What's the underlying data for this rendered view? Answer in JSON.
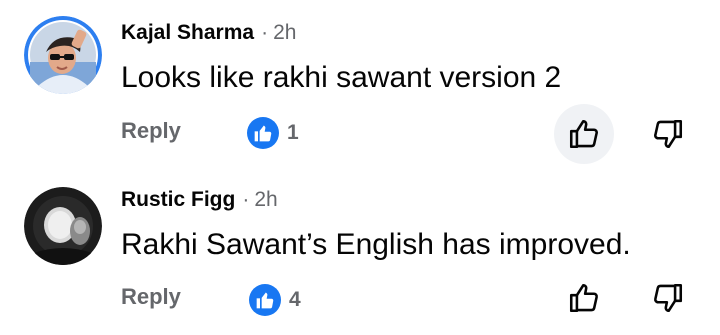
{
  "comments": [
    {
      "author": "Kajal Sharma",
      "separator": "·",
      "time": "2h",
      "text": "Looks like rakhi sawant version 2",
      "reply_label": "Reply",
      "like_count": "1",
      "avatar_icon": "profile-photo-person-with-sunglasses",
      "upvote_icon": "thumbs-up-outline-icon",
      "downvote_icon": "thumbs-down-outline-icon"
    },
    {
      "author": "Rustic Figg",
      "separator": "·",
      "time": "2h",
      "text": "Rakhi Sawant’s English has improved.",
      "reply_label": "Reply",
      "like_count": "4",
      "avatar_icon": "profile-photo-dark-monochrome",
      "upvote_icon": "thumbs-up-outline-icon",
      "downvote_icon": "thumbs-down-outline-icon"
    }
  ],
  "colors": {
    "like_blue": "#1877f2",
    "secondary_text": "#65676b",
    "primary_text": "#050505",
    "pressed_bg": "#f0f2f5"
  }
}
